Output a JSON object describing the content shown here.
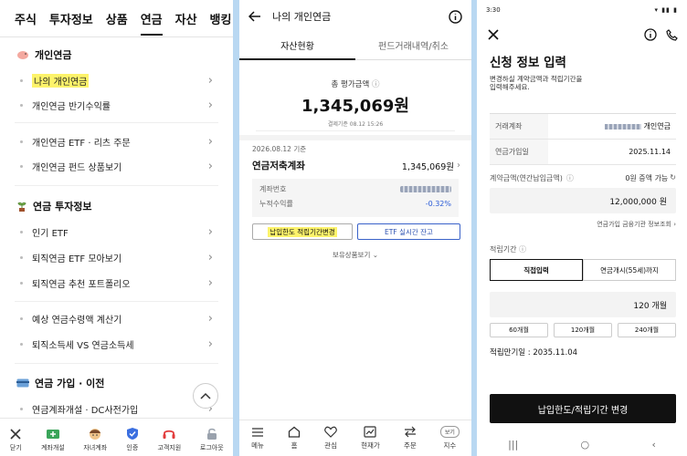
{
  "p1": {
    "tabs": [
      "주식",
      "투자정보",
      "상품",
      "연금",
      "자산",
      "뱅킹"
    ],
    "sec1": "개인연금",
    "items1": [
      "나의 개인연금",
      "개인연금 반기수익률"
    ],
    "items1b": [
      "개인연금 ETF · 리츠 주문",
      "개인연금 펀드 상품보기"
    ],
    "sec2": "연금 투자정보",
    "items2": [
      "인기 ETF",
      "퇴직연금 ETF 모아보기",
      "퇴직연금 추천 포트폴리오"
    ],
    "items2b": [
      "예상 연금수령액 계산기",
      "퇴직소득세 VS 연금소득세"
    ],
    "sec3": "연금 가입 · 이전",
    "items3": [
      "연금계좌개설 · DC사전가입"
    ],
    "bottom": [
      "닫기",
      "계좌개설",
      "자녀계좌",
      "인증",
      "고객지원",
      "로그아웃"
    ]
  },
  "p2": {
    "title": "나의 개인연금",
    "tabs": [
      "자산현황",
      "펀드거래내역/취소"
    ],
    "total_label": "총 평가금액",
    "total_value": "1,345,069원",
    "total_date": "결제기준 08.12 15:26",
    "asof": "2026.08.12 기준",
    "account_name": "연금저축계좌",
    "account_value": "1,345,069원",
    "acct_no_label": "계좌번호",
    "return_label": "누적수익률",
    "return_value": "-0.32%",
    "btn_limit": "납입한도 적립기간변경",
    "btn_etf": "ETF 실시간 잔고",
    "holdings": "보유상품보기",
    "bottom": [
      "메뉴",
      "홈",
      "관심",
      "현재가",
      "주문",
      "지수"
    ],
    "bottom_badge": "보기"
  },
  "p3": {
    "time": "3:30",
    "title": "신청 정보 입력",
    "subtitle1": "변경하실 계약금액과 적립기간을",
    "subtitle2": "입력해주세요.",
    "rows": [
      {
        "k": "거래계좌",
        "v": "개인연금"
      },
      {
        "k": "연금가입일",
        "v": "2025.11.14"
      }
    ],
    "amount_label": "계약금액(연간납입금액)",
    "amount_hint": "0원 증액 가능",
    "amount_value": "12,000,000 원",
    "link": "연금가입 금융기관 정보조회",
    "period_label": "적립기간",
    "seg": [
      "직접입력",
      "연금개시(55세)까지"
    ],
    "months_value": "120 개월",
    "pills": [
      "60개월",
      "120개월",
      "240개월"
    ],
    "end_label": "적립만기일 : 2035.11.04",
    "cta": "납입한도/적립기간 변경"
  }
}
